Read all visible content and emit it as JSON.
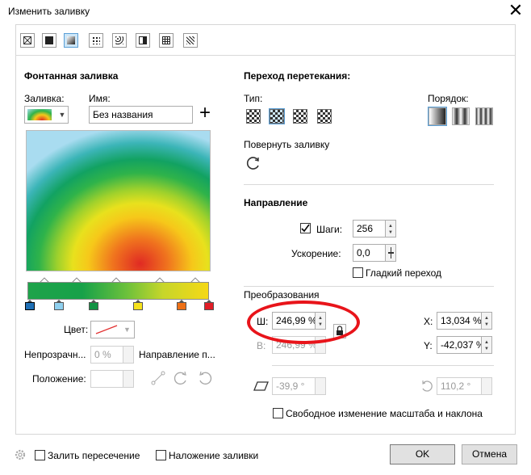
{
  "window": {
    "title": "Изменить заливку"
  },
  "fill_types": [
    "no-fill",
    "uniform-fill",
    "fountain-fill",
    "pattern-vector-fill",
    "pattern-bitmap-fill",
    "two-color-pattern-fill",
    "texture-fill",
    "postscript-fill"
  ],
  "left": {
    "section_title": "Фонтанная заливка",
    "fill_label": "Заливка:",
    "name_label": "Имя:",
    "name_value": "Без названия",
    "color_label": "Цвет:",
    "opacity_label": "Непрозрачн...",
    "opacity_value": "0 %",
    "direction_label": "Направление п...",
    "position_label": "Положение:",
    "node_colors": [
      "#1f6fb5",
      "#8fd0ef",
      "#119343",
      "#f7e21b",
      "#ee7016",
      "#e11d26"
    ]
  },
  "right": {
    "blend_title": "Переход перетекания:",
    "type_label": "Тип:",
    "order_label": "Порядок:",
    "rotate_label": "Повернуть заливку",
    "direction_title": "Направление",
    "steps_label": "Шаги:",
    "steps_value": "256",
    "accel_label": "Ускорение:",
    "accel_value": "0,0",
    "smooth_label": "Гладкий переход",
    "transform_title": "Преобразования",
    "w_label": "Ш:",
    "w_value": "246,99 %",
    "h_label": "В:",
    "h_value": "246,99 %",
    "x_label": "X:",
    "x_value": "13,034 %",
    "y_label": "Y:",
    "y_value": "-42,037 %",
    "skew_value": "-39,9 °",
    "rotate_value": "110,2 °",
    "free_scale_label": "Свободное изменение масштаба и наклона"
  },
  "footer": {
    "fill_intersection_label": "Залить пересечение",
    "overprint_label": "Наложение заливки",
    "ok_label": "OK",
    "cancel_label": "Отмена"
  },
  "colors": {
    "accent": "#5a9fd6",
    "annotation": "#e8141a"
  }
}
